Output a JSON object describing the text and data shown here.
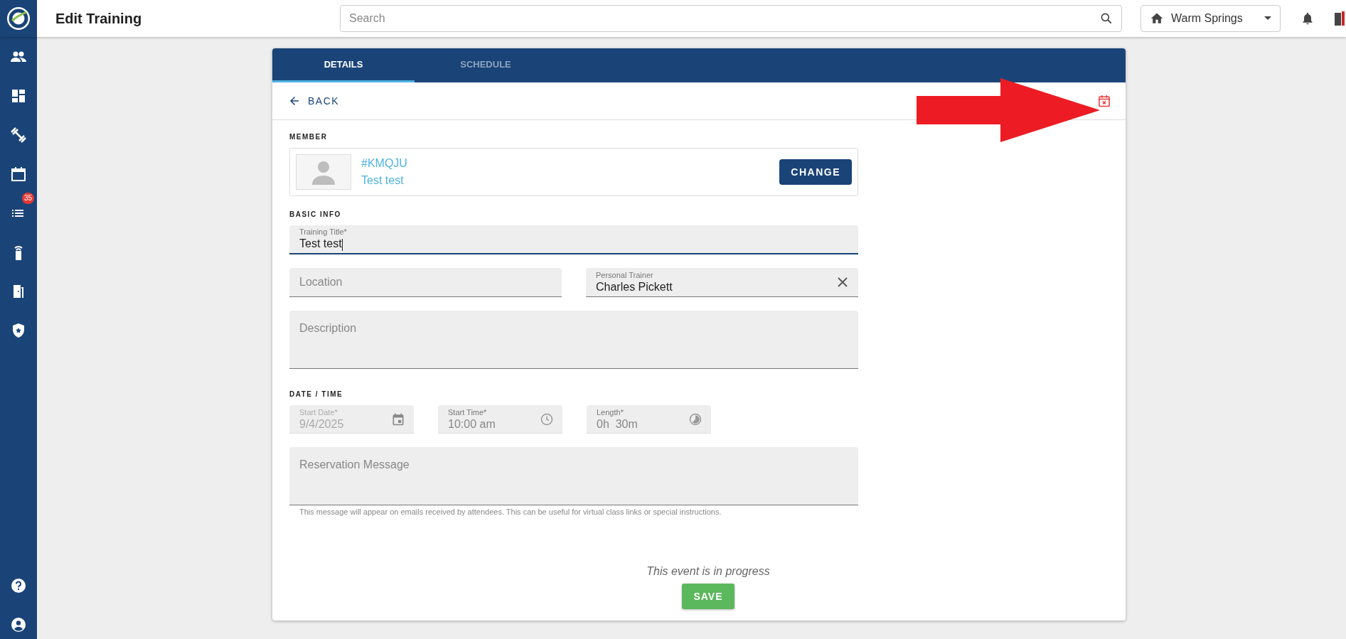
{
  "app_bar": {
    "title": "Edit Training",
    "search": {
      "placeholder": "Search"
    },
    "location": "Warm Springs"
  },
  "sidebar": {
    "badge": "35"
  },
  "tabs": [
    {
      "label": "DETAILS",
      "selected": true
    },
    {
      "label": "SCHEDULE",
      "selected": false
    }
  ],
  "back": "BACK",
  "member": {
    "heading": "MEMBER",
    "code": "#KMQJU",
    "name": "Test test",
    "button": "CHANGE"
  },
  "basic_info": {
    "heading": "BASIC INFO",
    "fields": [
      {
        "kind": "full",
        "label": "Training Title*",
        "value": "Test test",
        "focused": true
      },
      {
        "kind": "half",
        "placeholder": "Location"
      },
      {
        "kind": "half",
        "label": "Personal Trainer",
        "value": "Charles Pickett",
        "clearable": true
      },
      {
        "kind": "area",
        "placeholder": "Description"
      }
    ]
  },
  "date_time": {
    "heading": "DATE / TIME",
    "fields": [
      {
        "label": "Start Date*",
        "value": "9/4/2025",
        "disabled": true
      },
      {
        "label": "Start Time*",
        "value": "10:00 am",
        "disabled": false
      },
      {
        "label": "Length*",
        "value": "0h  30m",
        "disabled": false
      }
    ]
  },
  "reservation": {
    "placeholder": "Reservation Message",
    "hint": "This message will appear on emails received by attendees. This can be useful for virtual class links or special instructions."
  },
  "status": "This event is in progress",
  "save": "SAVE"
}
